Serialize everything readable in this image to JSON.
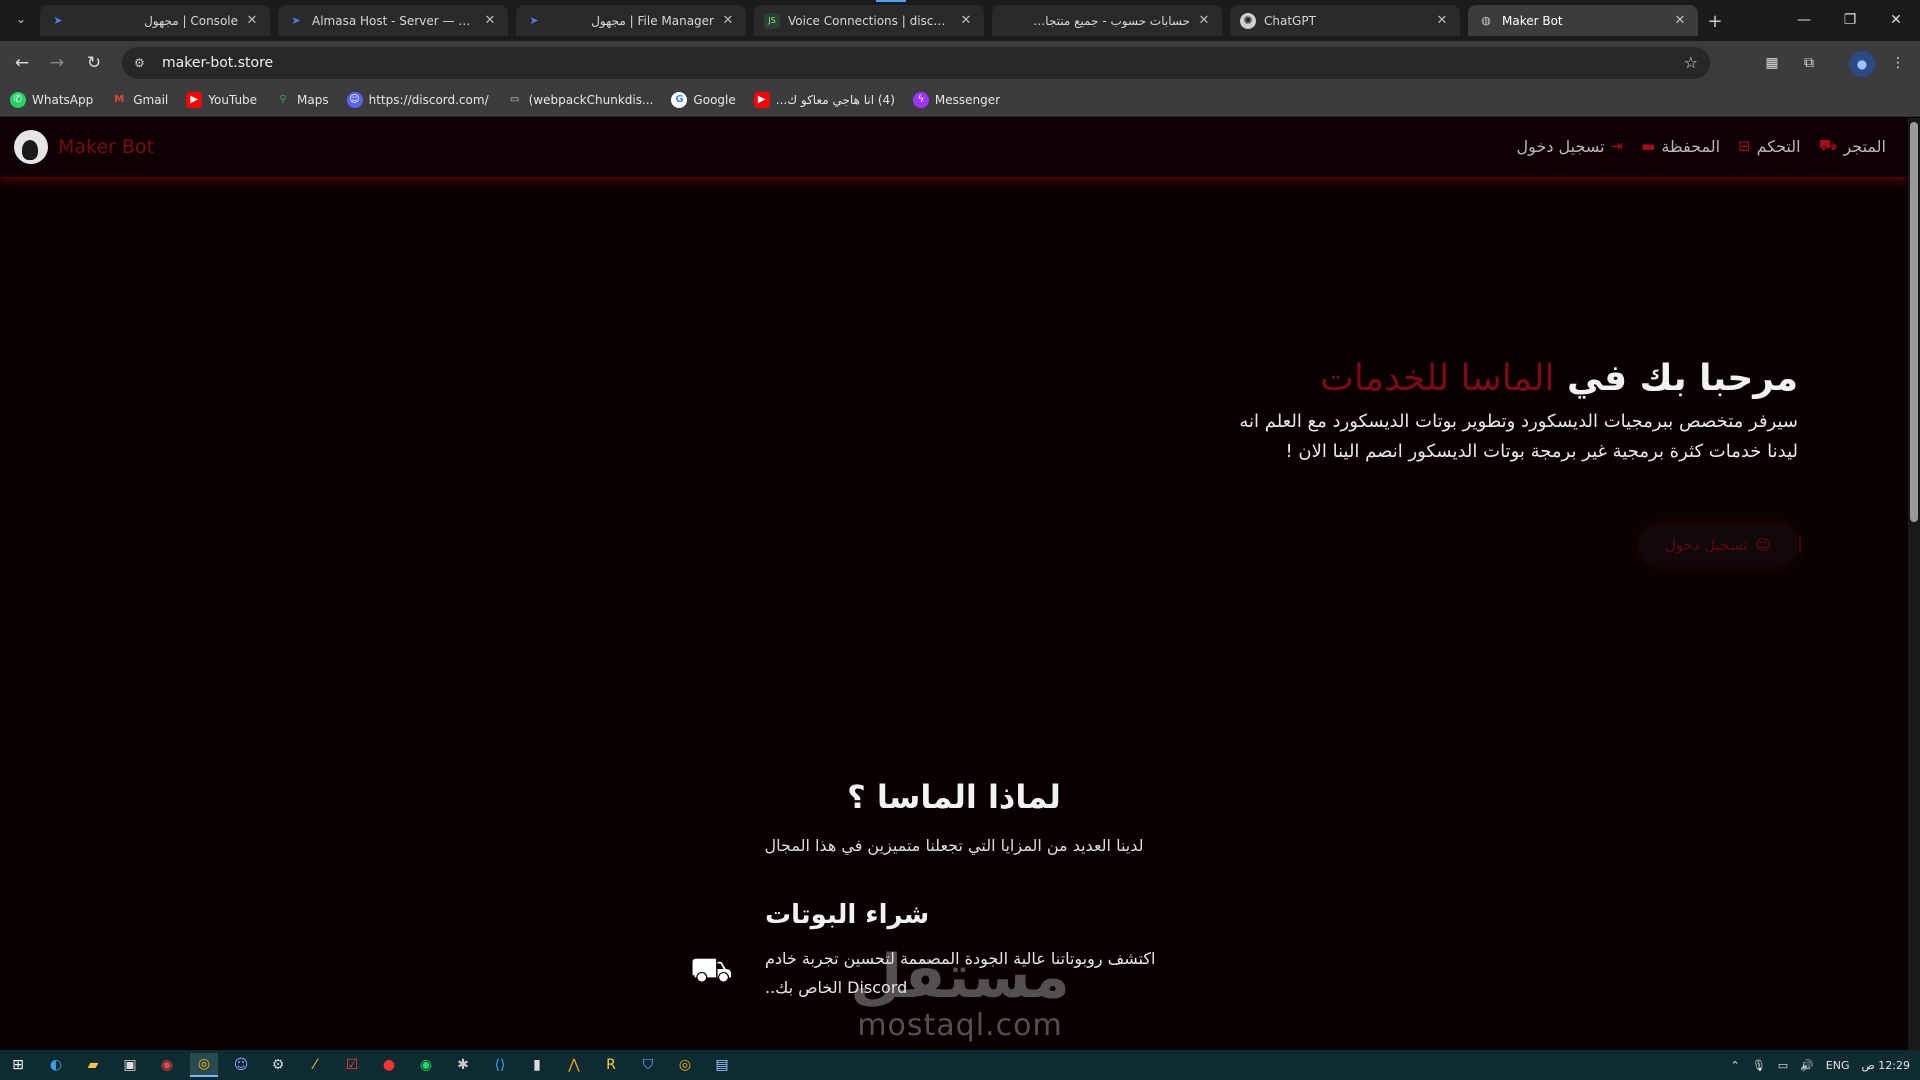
{
  "browser": {
    "tabs": [
      {
        "title": "Console | مجهول",
        "icon": "arrow-logo-icon",
        "rtl": true
      },
      {
        "title": "Almasa Host - Server — مجهول",
        "icon": "arrow-logo-icon",
        "rtl": false
      },
      {
        "title": "File Manager | مجهول",
        "icon": "arrow-logo-icon",
        "rtl": true
      },
      {
        "title": "Voice Connections | discord.js",
        "icon": "djs-icon",
        "rtl": false
      },
      {
        "title": "حسابات حسوب - جميع منتجات حسوب",
        "icon": "hsoub-icon",
        "rtl": true
      },
      {
        "title": "ChatGPT",
        "icon": "chatgpt-icon",
        "rtl": false
      },
      {
        "title": "Maker Bot",
        "icon": "globe-icon",
        "rtl": false
      }
    ],
    "url": "maker-bot.store",
    "bookmarks": [
      {
        "label": "WhatsApp",
        "icon": "whatsapp-icon",
        "color": "#25d366"
      },
      {
        "label": "Gmail",
        "icon": "gmail-icon",
        "color": "#ea4335"
      },
      {
        "label": "YouTube",
        "icon": "youtube-icon",
        "color": "#ff0000"
      },
      {
        "label": "Maps",
        "icon": "maps-icon",
        "color": "#34a853"
      },
      {
        "label": "https://discord.com/",
        "icon": "discord-icon",
        "color": "#5865f2"
      },
      {
        "label": "(webpackChunkdis...",
        "icon": "folder-icon",
        "color": "#cccccc"
      },
      {
        "label": "Google",
        "icon": "google-icon",
        "color": "#ffffff"
      },
      {
        "label": "(4) انا هاجي معاكو ك...",
        "icon": "youtube-icon",
        "color": "#ff0000"
      },
      {
        "label": "Messenger",
        "icon": "messenger-icon",
        "color": "#a033ff"
      }
    ]
  },
  "site": {
    "brand": "Maker Bot",
    "nav": {
      "login": "تسجيل دخول",
      "wallet": "المحفظة",
      "control": "التحكم",
      "store": "المتجر"
    },
    "hero": {
      "title_main": "مرحبا بك في",
      "title_accent": "الماسا للخدمات",
      "description": "سيرفر متخصص ببرمجيات الديسكورد وتطوير بوتات الديسكورد مع العلم انه ليدنا خدمات كثرة برمجية غير برمجة بوتات الديسكور انصم الينا الان !",
      "login_button": "تسجيل دخول"
    },
    "why": {
      "title": "لماذا الماسا ؟",
      "subtitle": "لدينا العديد من المزايا التي تجعلنا متميزين في هذا المجال"
    },
    "feature": {
      "title": "شراء البوتات",
      "description": "اكتشف روبوتاتنا عالية الجودة المصممة لتحسين تجربة خادم Discord الخاص بك.."
    },
    "watermark": {
      "arabic": "مستقل",
      "latin": "mostaql.com"
    }
  },
  "taskbar": {
    "lang": "ENG",
    "time": "12:29 ص"
  },
  "colors": {
    "accent": "#7c0b14",
    "nav_icon": "#a50d1a",
    "page_bg": "#0a0002"
  }
}
